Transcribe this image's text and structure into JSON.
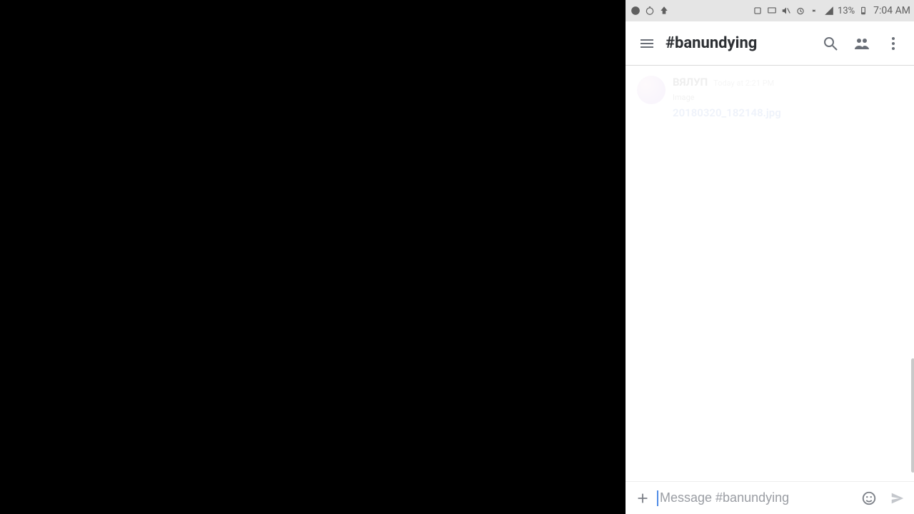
{
  "status_bar": {
    "battery_pct": "13%",
    "time": "7:04 AM"
  },
  "header": {
    "channel_title": "#banundying"
  },
  "faded_message": {
    "username": "ВЯЛУП",
    "timestamp": "Today at 2:21 PM",
    "label": "Image",
    "filename": "20180320_182148.jpg"
  },
  "composer": {
    "placeholder": "Message #banundying"
  },
  "icons": {
    "menu": "menu-icon",
    "search": "search-icon",
    "members": "people-icon",
    "overflow": "more-vert-icon",
    "attach": "plus-icon",
    "emoji": "emoji-icon",
    "send": "send-icon"
  }
}
